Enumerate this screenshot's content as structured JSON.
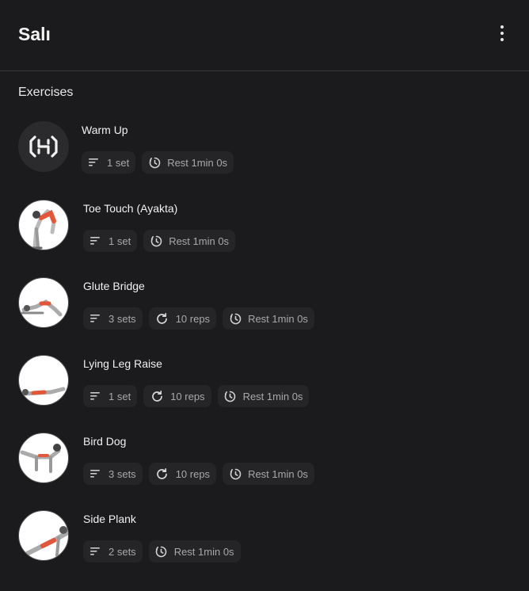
{
  "header": {
    "title": "Salı"
  },
  "section": {
    "title": "Exercises"
  },
  "exercises": [
    {
      "name": "Warm Up",
      "icon": "warmup-logo-icon",
      "sets": "1 set",
      "reps": null,
      "rest": "Rest 1min 0s"
    },
    {
      "name": "Toe Touch (Ayakta)",
      "icon": "toe-touch-illustration",
      "sets": "1 set",
      "reps": null,
      "rest": "Rest 1min 0s"
    },
    {
      "name": "Glute Bridge",
      "icon": "glute-bridge-illustration",
      "sets": "3 sets",
      "reps": "10 reps",
      "rest": "Rest 1min 0s"
    },
    {
      "name": "Lying Leg Raise",
      "icon": "lying-leg-raise-illustration",
      "sets": "1 set",
      "reps": "10 reps",
      "rest": "Rest 1min 0s"
    },
    {
      "name": "Bird Dog",
      "icon": "bird-dog-illustration",
      "sets": "3 sets",
      "reps": "10 reps",
      "rest": "Rest 1min 0s"
    },
    {
      "name": "Side Plank",
      "icon": "side-plank-illustration",
      "sets": "2 sets",
      "reps": null,
      "rest": "Rest 1min 0s"
    }
  ],
  "colors": {
    "background": "#1b1b1d",
    "chip_background": "#252527",
    "chip_text": "#a8a8a8",
    "accent_muscle": "#e2563a"
  }
}
